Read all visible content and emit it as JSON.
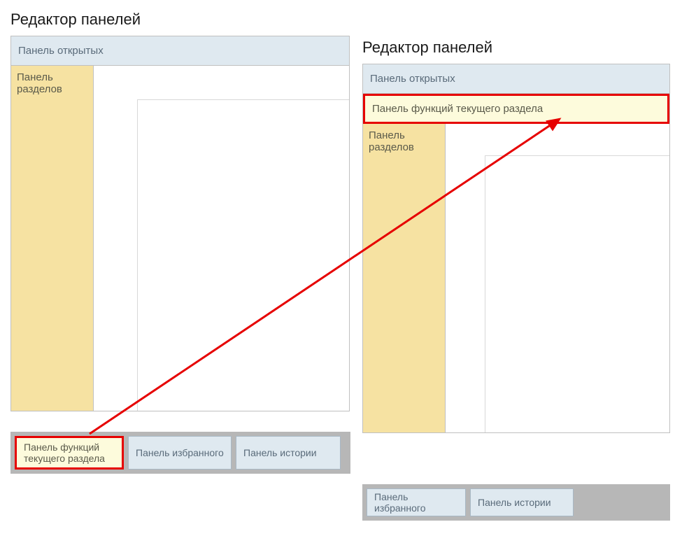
{
  "left": {
    "title": "Редактор панелей",
    "open_bar": "Панель открытых",
    "sections_panel": "Панель разделов"
  },
  "right": {
    "title": "Редактор панелей",
    "open_bar": "Панель открытых",
    "functions_bar": "Панель функций текущего раздела",
    "sections_panel": "Панель разделов"
  },
  "palette_left": {
    "functions": "Панель функций текущего раздела",
    "favorites": "Панель избранного",
    "history": "Панель истории"
  },
  "palette_right": {
    "favorites": "Панель избранного",
    "history": "Панель истории"
  },
  "annotation_color": "#e60000"
}
